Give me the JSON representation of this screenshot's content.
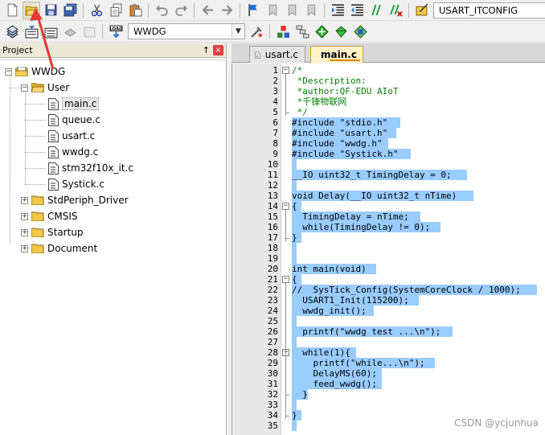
{
  "toolbar1": {
    "target_combo": "USART_ITCONFIG"
  },
  "toolbar2": {
    "target_combo": "WWDG"
  },
  "project_panel": {
    "title": "Project",
    "pin": "↑",
    "close": "×",
    "tree": {
      "root": "WWDG",
      "groups": [
        {
          "label": "User",
          "expanded": true,
          "files": [
            "main.c",
            "queue.c",
            "usart.c",
            "wwdg.c",
            "stm32f10x_it.c",
            "Systick.c"
          ]
        },
        {
          "label": "StdPeriph_Driver",
          "expanded": false
        },
        {
          "label": "CMSIS",
          "expanded": false
        },
        {
          "label": "Startup",
          "expanded": false
        },
        {
          "label": "Document",
          "expanded": false
        }
      ]
    }
  },
  "editor": {
    "tabs": [
      {
        "label": "usart.c",
        "active": false
      },
      {
        "label": "main.c",
        "active": true
      }
    ],
    "lines": [
      {
        "n": "1",
        "text": "/*",
        "cls": "cm",
        "fold": "minus"
      },
      {
        "n": "2",
        "text": " *Description:",
        "cls": "cm"
      },
      {
        "n": "3",
        "text": " *author:QF-EDU AIoT",
        "cls": "cm"
      },
      {
        "n": "4",
        "text": " *千锋物联网",
        "cls": "cm"
      },
      {
        "n": "5",
        "text": " */",
        "cls": "cm"
      },
      {
        "n": "6",
        "text": "#include \"stdio.h\"",
        "sel": 135
      },
      {
        "n": "7",
        "text": "#include \"usart.h\"",
        "sel": 130
      },
      {
        "n": "8",
        "text": "#include \"wwdg.h\"",
        "sel": 120
      },
      {
        "n": "9",
        "text": "#include \"Systick.h\"",
        "sel": 148
      },
      {
        "n": "10",
        "text": "",
        "sel": 6
      },
      {
        "n": "11",
        "text": "__IO uint32_t TimingDelay = 0;",
        "sel": 218
      },
      {
        "n": "12",
        "text": "",
        "sel": 6
      },
      {
        "n": "13",
        "text": "void Delay(__IO uint32_t nTime)",
        "sel": 226
      },
      {
        "n": "14",
        "text": "{",
        "sel": 12,
        "fold": "minus"
      },
      {
        "n": "15",
        "text": "  TimingDelay = nTime;",
        "sel": 160
      },
      {
        "n": "16",
        "text": "  while(TimingDelay != 0);",
        "sel": 185
      },
      {
        "n": "17",
        "text": "}",
        "sel": 12
      },
      {
        "n": "18",
        "text": "",
        "sel": 6
      },
      {
        "n": "19",
        "text": "",
        "sel": 6
      },
      {
        "n": "20",
        "text": "int main(void)",
        "sel": 105
      },
      {
        "n": "21",
        "text": "{",
        "sel": 12,
        "fold": "minus"
      },
      {
        "n": "22",
        "text": "//  SysTick_Config(SystemCoreClock / 1000);",
        "sel": 305
      },
      {
        "n": "23",
        "text": "  USART1_Init(115200);",
        "sel": 158
      },
      {
        "n": "24",
        "text": "  wwdg_init();",
        "sel": 102
      },
      {
        "n": "25",
        "text": "",
        "sel": 6
      },
      {
        "n": "26",
        "text": "  printf(\"wwdg test ...\\n\");",
        "sel": 200
      },
      {
        "n": "27",
        "text": "",
        "sel": 6
      },
      {
        "n": "28",
        "text": "  while(1){",
        "sel": 80,
        "fold": "minus"
      },
      {
        "n": "29",
        "text": "    printf(\"while...\\n\");",
        "sel": 178
      },
      {
        "n": "30",
        "text": "    DelayMS(60);",
        "sel": 112
      },
      {
        "n": "31",
        "text": "    feed_wwdg();",
        "sel": 112
      },
      {
        "n": "32",
        "text": "  }",
        "sel": 20
      },
      {
        "n": "33",
        "text": "",
        "sel": 6
      },
      {
        "n": "34",
        "text": "}",
        "sel": 12
      },
      {
        "n": "35",
        "text": "",
        "sel": 6
      }
    ]
  },
  "watermark": "CSDN @ycjunhua",
  "colors": {
    "selection": "#99ccff",
    "comment": "#008000",
    "arrow": "#e53935"
  }
}
